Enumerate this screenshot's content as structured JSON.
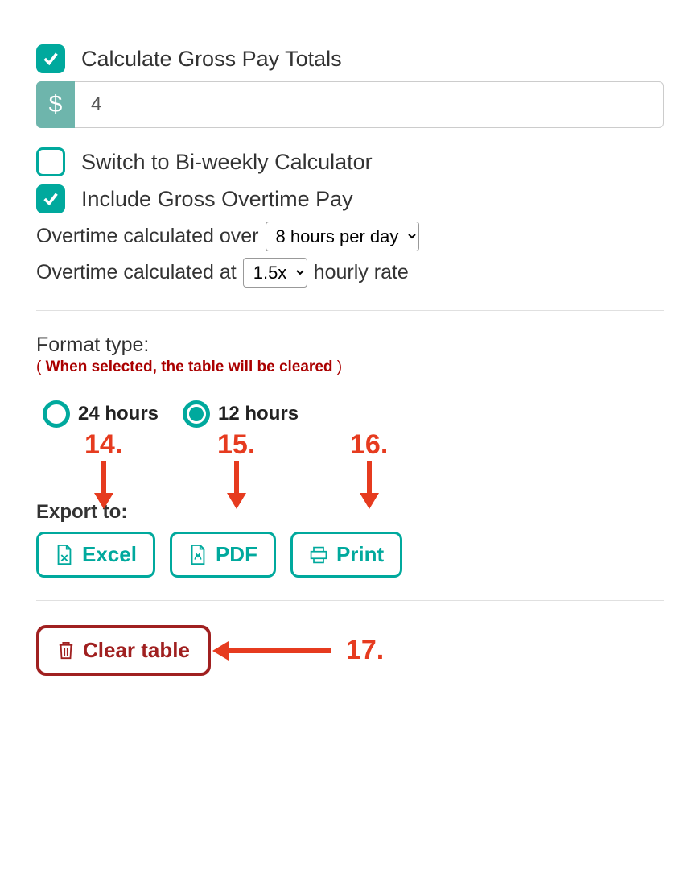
{
  "checkboxes": {
    "gross_pay": {
      "label": "Calculate Gross Pay Totals",
      "checked": true
    },
    "biweekly": {
      "label": "Switch to Bi-weekly Calculator",
      "checked": false
    },
    "include_ot": {
      "label": "Include Gross Overtime Pay",
      "checked": true
    }
  },
  "rate_input": {
    "prefix": "$",
    "value": "4"
  },
  "overtime": {
    "over_label_pre": "Overtime calculated over",
    "over_select": "8 hours per day",
    "at_label_pre": "Overtime calculated at",
    "at_select": "1.5x",
    "at_label_post": "hourly rate"
  },
  "format": {
    "title": "Format type:",
    "warning_open": "( ",
    "warning_text": "When selected, the table will be cleared",
    "warning_close": " )",
    "options": {
      "h24": "24 hours",
      "h12": "12 hours"
    },
    "selected": "h12"
  },
  "export": {
    "title": "Export to:",
    "excel": "Excel",
    "pdf": "PDF",
    "print": "Print"
  },
  "clear": {
    "label": "Clear table"
  },
  "annotations": {
    "n14": "14.",
    "n15": "15.",
    "n16": "16.",
    "n17": "17."
  }
}
